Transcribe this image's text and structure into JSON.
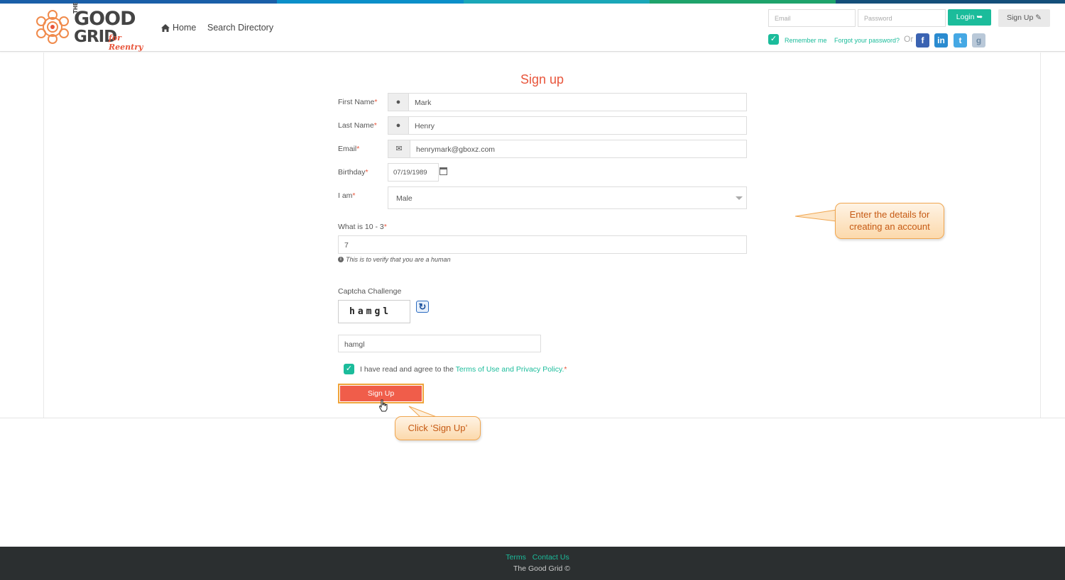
{
  "brand": {
    "logo_line1": "GOOD",
    "logo_the": "THE",
    "logo_line2": "GRID",
    "logo_tagline": "for Reentry",
    "stripe_colors": [
      "#1a5fa8",
      "#0b8fc9",
      "#1aa7b8",
      "#1ea36b",
      "#144f7a"
    ]
  },
  "nav": {
    "home": "Home",
    "search_directory": "Search Directory"
  },
  "login": {
    "email_placeholder": "Email",
    "password_placeholder": "Password",
    "login_button": "Login",
    "signup_button": "Sign Up",
    "remember_me": "Remember me",
    "forgot_password": "Forgot your password?",
    "or": "Or",
    "social_icons": [
      "facebook-icon",
      "linkedin-icon",
      "twitter-icon",
      "google-icon"
    ]
  },
  "form": {
    "title": "Sign up",
    "first_name": {
      "label": "First Name",
      "value": "Mark",
      "icon": "user-icon"
    },
    "last_name": {
      "label": "Last Name",
      "value": "Henry",
      "icon": "user-icon"
    },
    "email": {
      "label": "Email",
      "value": "henrymark@gboxz.com",
      "icon": "envelope-icon"
    },
    "birthday": {
      "label": "Birthday",
      "value": "07/19/1989"
    },
    "gender": {
      "label": "I am",
      "value": "Male"
    },
    "math": {
      "label": "What is 10 - 3",
      "value": "7",
      "hint": "This is to verify that you are a human"
    },
    "captcha": {
      "label": "Captcha Challenge",
      "image_text": "hamgl",
      "value": "hamgl"
    },
    "agree": {
      "prefix": "I have read and agree to the ",
      "link": "Terms of Use and Privacy Policy",
      "suffix": "."
    },
    "required_mark": "*",
    "submit": "Sign Up"
  },
  "callouts": {
    "details": "Enter the details for creating an account",
    "click": "Click ‘Sign Up’"
  },
  "footer": {
    "terms": "Terms",
    "contact": "Contact Us",
    "copyright": "The Good Grid ©"
  },
  "colors": {
    "accent_teal": "#1bbc9b",
    "accent_red": "#f05d4a",
    "footer_bg": "#2b2f30"
  }
}
